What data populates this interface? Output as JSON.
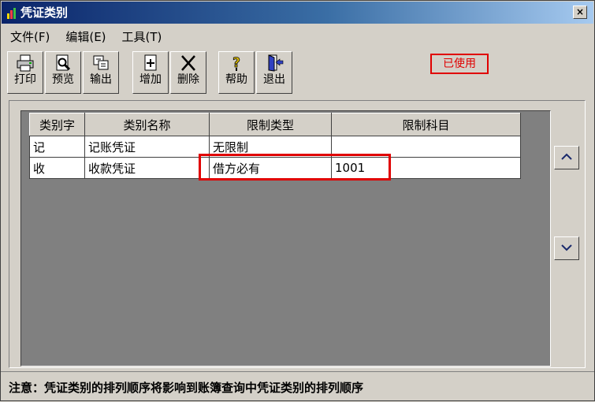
{
  "window": {
    "title": "凭证类别",
    "close_label": "×"
  },
  "menu": [
    {
      "label": "文件(F)"
    },
    {
      "label": "编辑(E)"
    },
    {
      "label": "工具(T)"
    }
  ],
  "toolbar": {
    "print": "打印",
    "preview": "预览",
    "export": "输出",
    "add": "增加",
    "delete": "删除",
    "help": "帮助",
    "exit": "退出"
  },
  "status_badge": "已使用",
  "table": {
    "columns": [
      "类别字",
      "类别名称",
      "限制类型",
      "限制科目"
    ],
    "rows": [
      [
        "记",
        "记账凭证",
        "无限制",
        ""
      ],
      [
        "收",
        "收款凭证",
        "借方必有",
        "1001"
      ]
    ]
  },
  "note": "注意：凭证类别的排列顺序将影响到账簿查询中凭证类别的排列顺序",
  "colors": {
    "title_bar": "#0a246a",
    "highlight": "#e00000",
    "face": "#d4d0c8",
    "grid_bg": "#808080"
  },
  "icons": [
    "app-icon",
    "printer-icon",
    "preview-icon",
    "export-icon",
    "add-icon",
    "delete-icon",
    "help-icon",
    "exit-icon",
    "arrow-up-icon",
    "arrow-down-icon"
  ]
}
